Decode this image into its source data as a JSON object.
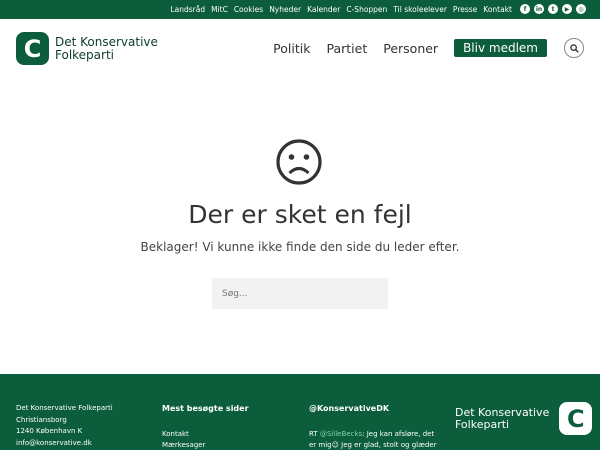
{
  "topnav": {
    "links": [
      "Landsråd",
      "MitC",
      "Cookies",
      "Nyheder",
      "Kalender",
      "C-Shoppen",
      "Til skoleelever",
      "Presse",
      "Kontakt"
    ],
    "social_icons": [
      "facebook-icon",
      "linkedin-icon",
      "twitter-icon",
      "youtube-icon",
      "instagram-icon"
    ]
  },
  "header": {
    "logo_letter": "C",
    "logo_line1": "Det Konservative",
    "logo_line2": "Folkeparti",
    "nav": [
      "Politik",
      "Partiet",
      "Personer"
    ],
    "join_label": "Bliv medlem",
    "search_icon": "search-icon"
  },
  "error": {
    "icon": "sad-face-icon",
    "title": "Der er sket en fejl",
    "message": "Beklager! Vi kunne ikke finde den side du leder efter.",
    "search_placeholder": "Søg..."
  },
  "footer": {
    "address": [
      "Det Konservative Folkeparti",
      "Christiansborg",
      "1240 København K",
      "info@konservative.dk"
    ],
    "popular_heading": "Mest besøgte sider",
    "popular_links": [
      "Kontakt",
      "Mærkesager"
    ],
    "twitter_heading": "@KonservativeDK",
    "tweet_prefix": "RT ",
    "tweet_handle": "@SilleBecks",
    "tweet_text": ": Jeg kan afsløre, det er mig☺ Jeg er glad, stolt og glæder mig til at arbejde sammen med",
    "logo_line1": "Det Konservative",
    "logo_line2": "Folkeparti",
    "logo_letter": "C"
  },
  "colors": {
    "brand_green": "#0b5d3b",
    "tweet_link": "#7fd3a8"
  }
}
